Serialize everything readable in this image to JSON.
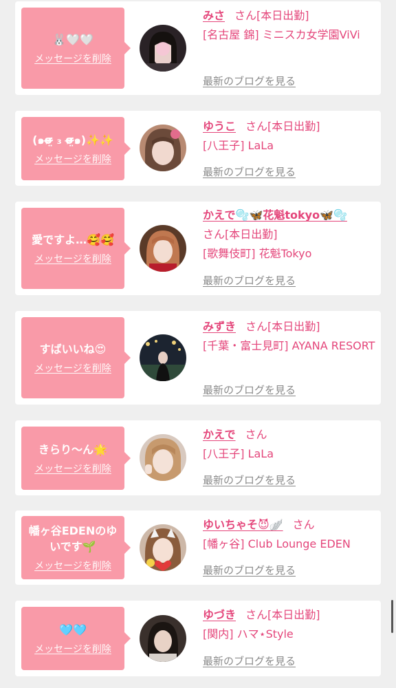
{
  "delete_label": "メッセージを削除",
  "blog_label": "最新のブログを見る",
  "colors": {
    "accent": "#e4457a",
    "bubble": "#f99aa8",
    "link_gray": "#8a8a8a"
  },
  "items": [
    {
      "message": "🐰🤍🤍",
      "name": "みさ",
      "san": "さん",
      "status": "[本日出勤]",
      "shop": "[名古屋 錦] ミニスカ女学園ViVi"
    },
    {
      "message": "(๑σ̴̶̷̤ ₃ σ̴̶̷̤๑)✨✨",
      "name": "ゆうこ",
      "san": "さん",
      "status": "[本日出勤]",
      "shop": "[八王子] LaLa"
    },
    {
      "message": "愛ですよ…🥰🥰",
      "name": "かえで🫧🦋花魁tokyo🦋🫧",
      "san": "さん",
      "status": "[本日出勤]",
      "shop": "[歌舞伎町] 花魁Tokyo"
    },
    {
      "message": "すばいいね😍",
      "name": "みずき",
      "san": "さん",
      "status": "[本日出勤]",
      "shop": "[千葉・富士見町] AYANA RESORT"
    },
    {
      "message": "きらり〜ん🌟",
      "name": "かえで",
      "san": "さん",
      "status": "",
      "shop": "[八王子] LaLa"
    },
    {
      "message": "幡ヶ谷EDENのゆいです🌱",
      "name": "ゆいちゃそ😈🪽",
      "san": "さん",
      "status": "",
      "shop": "[幡ヶ谷] Club Lounge EDEN"
    },
    {
      "message": "🩵🩵",
      "name": "ゆづき",
      "san": "さん",
      "status": "[本日出勤]",
      "shop": "[関内] ハマ⋆Style"
    }
  ]
}
